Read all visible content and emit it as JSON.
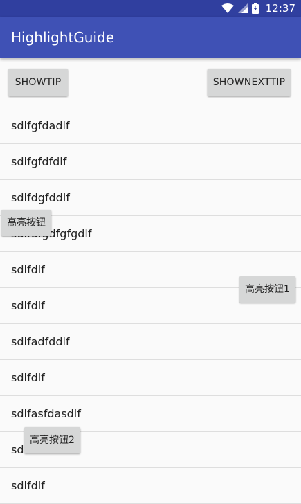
{
  "status_bar": {
    "time": "12:37",
    "icons": [
      "wifi-icon",
      "signal-icon",
      "battery-icon"
    ]
  },
  "app_bar": {
    "title": "HighlightGuide"
  },
  "toolbar": {
    "show_tip_label": "SHOWTIP",
    "show_next_tip_label": "SHOWNEXTTIP"
  },
  "list": {
    "items": [
      "sdlfgfdadlf",
      "sdlfgfdfdlf",
      "sdlfdgfddlf",
      "sdlfdfgdfgfgdlf",
      "sdlfdlf",
      "sdlfdlf",
      "sdlfadfddlf",
      "sdlfdlf",
      "sdlfasfdasdlf",
      "sdlfasfddfdlf",
      "sdlfdlf"
    ]
  },
  "highlight_buttons": {
    "btn0": "高亮按钮",
    "btn1": "高亮按钮1",
    "btn2": "高亮按钮2"
  },
  "colors": {
    "status_bar": "#303F9F",
    "app_bar": "#3F51B5",
    "button": "#D6D7D7",
    "background": "#FAFAFA"
  }
}
